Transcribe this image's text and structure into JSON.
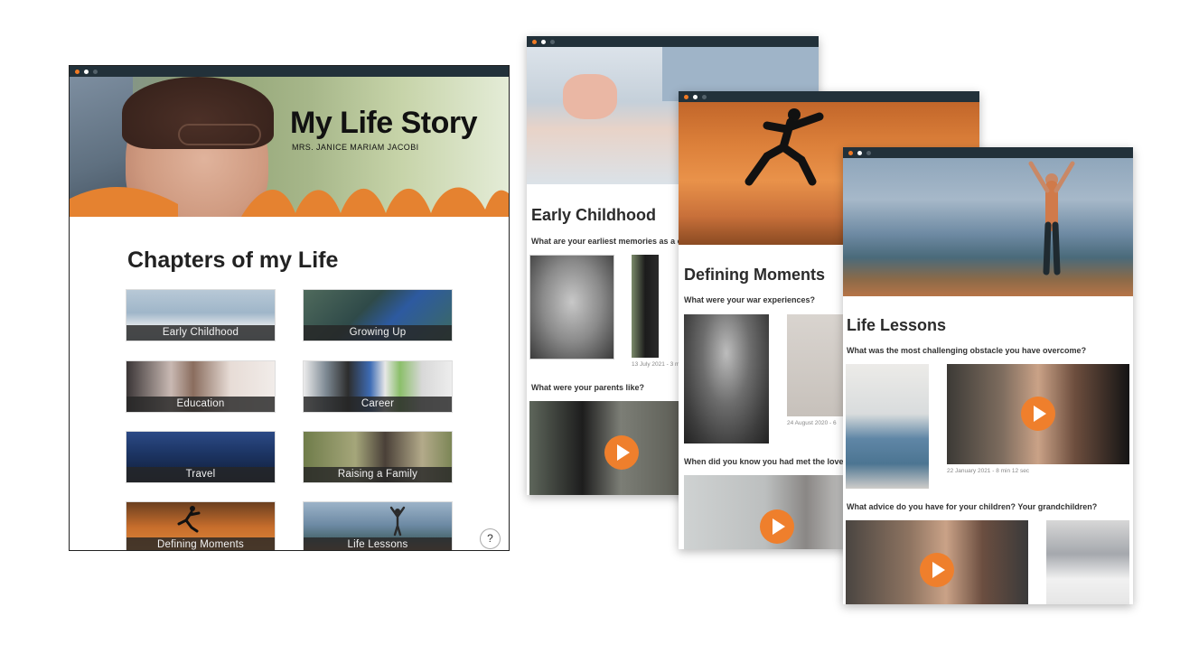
{
  "main": {
    "title": "My Life Story",
    "subtitle": "MRS. JANICE MARIAM JACOBI",
    "chapters_heading": "Chapters of my Life",
    "chapters": [
      {
        "label": "Early Childhood"
      },
      {
        "label": "Growing Up"
      },
      {
        "label": "Education"
      },
      {
        "label": "Career"
      },
      {
        "label": "Travel"
      },
      {
        "label": "Raising a Family"
      },
      {
        "label": "Defining Moments"
      },
      {
        "label": "Life Lessons"
      }
    ],
    "help_label": "?"
  },
  "early_childhood": {
    "title": "Early Childhood",
    "question1": "What are your earliest memories as a ch",
    "meta1": "13 July 2021 - 3 m",
    "question2": "What were your parents like?"
  },
  "defining_moments": {
    "title": "Defining Moments",
    "question1": "What were your war experiences?",
    "meta1": "24 August 2020 - 6",
    "question2": "When did you know you had met the love"
  },
  "life_lessons": {
    "title": "Life Lessons",
    "question1": "What was the most challenging obstacle you have overcome?",
    "meta1": "22 January 2021 - 8 min 12 sec",
    "question2": "What advice do you have for your children?  Your grandchildren?"
  },
  "colors": {
    "accent": "#ef7f2c",
    "titlebar": "#22313a",
    "caption_bg": "#262626"
  }
}
